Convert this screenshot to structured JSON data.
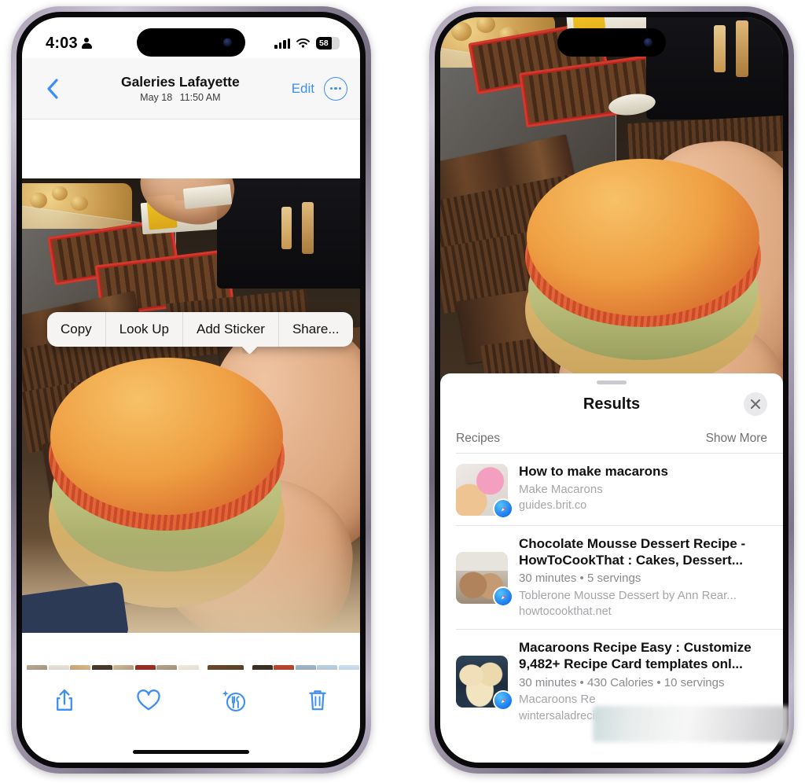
{
  "left_phone": {
    "status_bar": {
      "time": "4:03",
      "battery_level": "58",
      "battery_percent": 66,
      "icons": {
        "person": "person-icon",
        "cellular": "cellular-bars-icon",
        "wifi": "wifi-icon",
        "battery": "battery-icon"
      }
    },
    "nav": {
      "back_label": "chevron-left-icon",
      "title": "Galeries Lafayette",
      "date": "May 18",
      "time": "11:50 AM",
      "edit_label": "Edit",
      "more_label": "more-circle-icon"
    },
    "context_menu": {
      "items": [
        {
          "label": "Copy"
        },
        {
          "label": "Look Up"
        },
        {
          "label": "Add Sticker"
        },
        {
          "label": "Share..."
        }
      ]
    },
    "toolbar": {
      "share_label": "share-icon",
      "favorite_label": "heart-icon",
      "visual_lookup_label": "visual-lookup-food-icon",
      "delete_label": "trash-icon"
    }
  },
  "right_phone": {
    "sheet": {
      "title": "Results",
      "close_label": "close-icon",
      "section_label": "Recipes",
      "show_more_label": "Show More",
      "results": [
        {
          "title": "How to make macarons",
          "meta": "",
          "subtitle": "Make Macarons",
          "url": "guides.brit.co",
          "badge": "safari-icon"
        },
        {
          "title": "Chocolate Mousse Dessert Recipe - HowToCookThat : Cakes, Dessert...",
          "meta": "30 minutes • 5 servings",
          "subtitle": "Toblerone Mousse Dessert by Ann Rear...",
          "url": "howtocookthat.net",
          "badge": "safari-icon"
        },
        {
          "title": "Macaroons Recipe Easy : Customize 9,482+ Recipe Card templates onl...",
          "meta": "30 minutes • 430 Calories • 10 servings",
          "subtitle": "Macaroons Re",
          "url": "wintersaladrecip",
          "badge": "safari-icon"
        }
      ]
    }
  },
  "colors": {
    "accent_blue": "#3d8ef5",
    "sheet_bg": "#ffffff",
    "nav_bg": "#f7f7f7",
    "muted_text": "#8a8a8f"
  }
}
